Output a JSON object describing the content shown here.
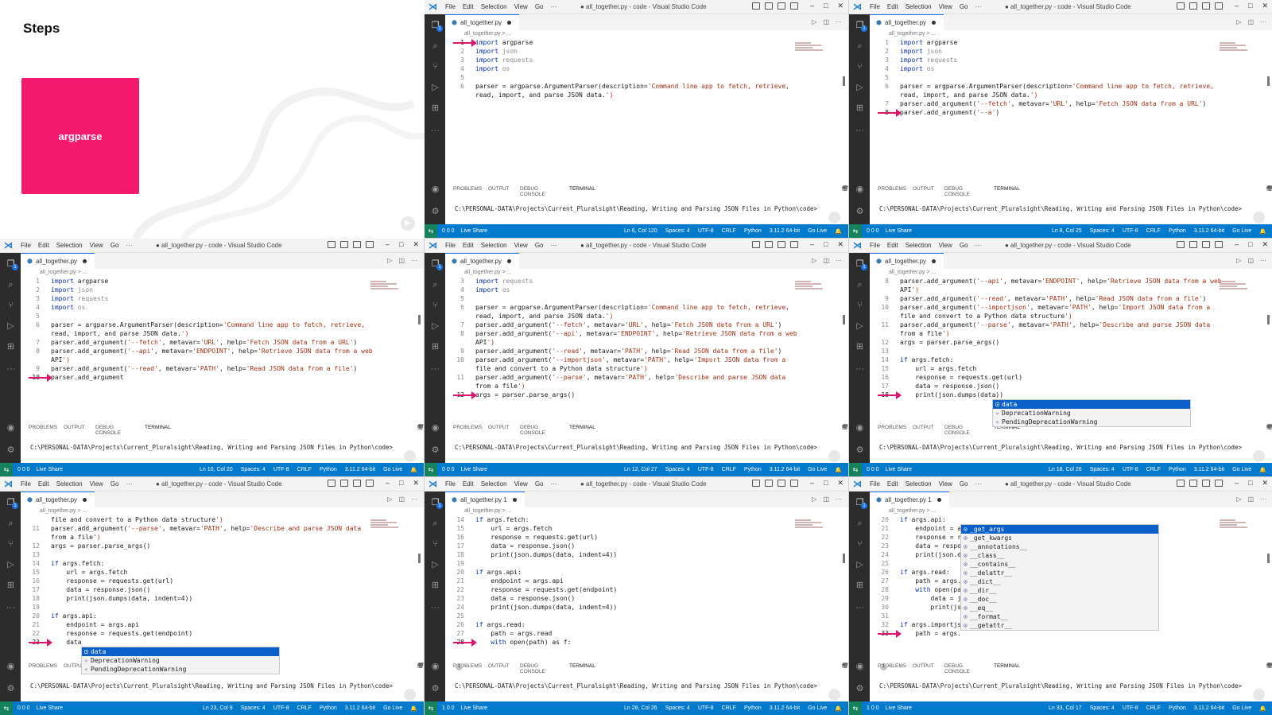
{
  "slide": {
    "title": "Steps",
    "card_label": "argparse"
  },
  "window": {
    "menu": [
      "File",
      "Edit",
      "Selection",
      "View",
      "Go",
      "···"
    ],
    "file": "all_together.py",
    "breadcrumb": "all_together.py > ...",
    "terminal_tabs": [
      "PROBLEMS",
      "OUTPUT",
      "DEBUG CONSOLE",
      "TERMINAL"
    ],
    "terminal_shell": "cmd",
    "terminal_prompt": "C:\\PERSONAL-DATA\\Projects\\Current_Pluralsight\\Reading, Writing and Parsing JSON Files in Python\\code>",
    "status_live_share": "Live Share",
    "status_spaces": "Spaces: 4",
    "status_encoding": "UTF-8",
    "status_eol": "CRLF",
    "status_language": "Python",
    "status_interpreter": "3.11.2 64-bit",
    "status_golive": "Go Live"
  },
  "colors": {
    "arrow": "#e0146d",
    "statusbar": "#007acc",
    "card": "#f3196f"
  },
  "panels": [
    {
      "title": "● all_together.py - code - Visual Studio Code",
      "tab": "all_together.py",
      "problems": "",
      "diagnostics": "0 0 0",
      "cursor": "Ln 6, Col 120",
      "arrow_line": 1,
      "lines": [
        {
          "n": "1",
          "t": "import argparse"
        },
        {
          "n": "2",
          "t": "import json"
        },
        {
          "n": "3",
          "t": "import requests"
        },
        {
          "n": "4",
          "t": "import os"
        },
        {
          "n": "5",
          "t": ""
        },
        {
          "n": "6",
          "t": "parser = argparse.ArgumentParser(description='Command line app to fetch, retrieve,"
        },
        {
          "n": "",
          "t": "read, import, and parse JSON data.')"
        }
      ],
      "autocomplete": []
    },
    {
      "title": "● all_together.py - code - Visual Studio Code",
      "tab": "all_together.py",
      "problems": "",
      "diagnostics": "0 0 0",
      "cursor": "Ln 8, Col 25",
      "arrow_line": 8,
      "lines": [
        {
          "n": "1",
          "t": "import argparse"
        },
        {
          "n": "2",
          "t": "import json"
        },
        {
          "n": "3",
          "t": "import requests"
        },
        {
          "n": "4",
          "t": "import os"
        },
        {
          "n": "5",
          "t": ""
        },
        {
          "n": "6",
          "t": "parser = argparse.ArgumentParser(description='Command line app to fetch, retrieve,"
        },
        {
          "n": "",
          "t": "read, import, and parse JSON data.')"
        },
        {
          "n": "7",
          "t": "parser.add_argument('--fetch', metavar='URL', help='Fetch JSON data from a URL')"
        },
        {
          "n": "8",
          "t": "parser.add_argument('--a')"
        }
      ],
      "autocomplete": []
    },
    {
      "title": "● all_together.py - code - Visual Studio Code",
      "tab": "all_together.py",
      "problems": "",
      "diagnostics": "0 0 0",
      "cursor": "Ln 10, Col 20",
      "arrow_line": 10,
      "lines": [
        {
          "n": "1",
          "t": "import argparse"
        },
        {
          "n": "2",
          "t": "import json"
        },
        {
          "n": "3",
          "t": "import requests"
        },
        {
          "n": "4",
          "t": "import os"
        },
        {
          "n": "5",
          "t": ""
        },
        {
          "n": "6",
          "t": "parser = argparse.ArgumentParser(description='Command line app to fetch, retrieve,"
        },
        {
          "n": "",
          "t": "read, import, and parse JSON data.')"
        },
        {
          "n": "7",
          "t": "parser.add_argument('--fetch', metavar='URL', help='Fetch JSON data from a URL')"
        },
        {
          "n": "8",
          "t": "parser.add_argument('--api', metavar='ENDPOINT', help='Retrieve JSON data from a web"
        },
        {
          "n": "",
          "t": "API')"
        },
        {
          "n": "9",
          "t": "parser.add_argument('--read', metavar='PATH', help='Read JSON data from a file')"
        },
        {
          "n": "10",
          "t": "parser.add_argument"
        }
      ],
      "autocomplete": []
    },
    {
      "title": "● all_together.py - code - Visual Studio Code",
      "tab": "all_together.py",
      "problems": "",
      "diagnostics": "0 0 0",
      "cursor": "Ln 12, Col 27",
      "arrow_line": 12,
      "lines": [
        {
          "n": "3",
          "t": "import requests"
        },
        {
          "n": "4",
          "t": "import os"
        },
        {
          "n": "5",
          "t": ""
        },
        {
          "n": "6",
          "t": "parser = argparse.ArgumentParser(description='Command line app to fetch, retrieve,"
        },
        {
          "n": "",
          "t": "read, import, and parse JSON data.')"
        },
        {
          "n": "7",
          "t": "parser.add_argument('--fetch', metavar='URL', help='Fetch JSON data from a URL')"
        },
        {
          "n": "8",
          "t": "parser.add_argument('--api', metavar='ENDPOINT', help='Retrieve JSON data from a web"
        },
        {
          "n": "",
          "t": "API')"
        },
        {
          "n": "9",
          "t": "parser.add_argument('--read', metavar='PATH', help='Read JSON data from a file')"
        },
        {
          "n": "10",
          "t": "parser.add_argument('--importjson', metavar='PATH', help='Import JSON data from a"
        },
        {
          "n": "",
          "t": "file and convert to a Python data structure')"
        },
        {
          "n": "11",
          "t": "parser.add_argument('--parse', metavar='PATH', help='Describe and parse JSON data"
        },
        {
          "n": "",
          "t": "from a file')"
        },
        {
          "n": "12",
          "t": "args = parser.parse_args()"
        }
      ],
      "autocomplete": []
    },
    {
      "title": "● all_together.py - code - Visual Studio Code",
      "tab": "all_together.py",
      "problems": "",
      "diagnostics": "0 0 0",
      "cursor": "Ln 18, Col 26",
      "arrow_line": 18,
      "lines": [
        {
          "n": "8",
          "t": "parser.add_argument('--api', metavar='ENDPOINT', help='Retrieve JSON data from a web"
        },
        {
          "n": "",
          "t": "API')"
        },
        {
          "n": "9",
          "t": "parser.add_argument('--read', metavar='PATH', help='Read JSON data from a file')"
        },
        {
          "n": "10",
          "t": "parser.add_argument('--importjson', metavar='PATH', help='Import JSON data from a"
        },
        {
          "n": "",
          "t": "file and convert to a Python data structure')"
        },
        {
          "n": "11",
          "t": "parser.add_argument('--parse', metavar='PATH', help='Describe and parse JSON data"
        },
        {
          "n": "",
          "t": "from a file')"
        },
        {
          "n": "12",
          "t": "args = parser.parse_args()"
        },
        {
          "n": "13",
          "t": ""
        },
        {
          "n": "14",
          "t": "if args.fetch:"
        },
        {
          "n": "15",
          "t": "    url = args.fetch"
        },
        {
          "n": "16",
          "t": "    response = requests.get(url)"
        },
        {
          "n": "17",
          "t": "    data = response.json()"
        },
        {
          "n": "18",
          "t": "    print(json.dumps(data))"
        }
      ],
      "autocomplete": [
        "data",
        "DeprecationWarning",
        "PendingDeprecationWarning"
      ]
    },
    {
      "title": "● all_together.py - code - Visual Studio Code",
      "tab": "all_together.py",
      "problems": "",
      "diagnostics": "0 0 0",
      "cursor": "Ln 23, Col 9",
      "arrow_line": 23,
      "lines": [
        {
          "n": "",
          "t": "file and convert to a Python data structure')"
        },
        {
          "n": "11",
          "t": "parser.add_argument('--parse', metavar='PATH', help='Describe and parse JSON data"
        },
        {
          "n": "",
          "t": "from a file')"
        },
        {
          "n": "12",
          "t": "args = parser.parse_args()"
        },
        {
          "n": "13",
          "t": ""
        },
        {
          "n": "14",
          "t": "if args.fetch:"
        },
        {
          "n": "15",
          "t": "    url = args.fetch"
        },
        {
          "n": "16",
          "t": "    response = requests.get(url)"
        },
        {
          "n": "17",
          "t": "    data = response.json()"
        },
        {
          "n": "18",
          "t": "    print(json.dumps(data, indent=4))"
        },
        {
          "n": "19",
          "t": ""
        },
        {
          "n": "20",
          "t": "if args.api:"
        },
        {
          "n": "21",
          "t": "    endpoint = args.api"
        },
        {
          "n": "22",
          "t": "    response = requests.get(endpoint)"
        },
        {
          "n": "23",
          "t": "    data"
        }
      ],
      "autocomplete": [
        "data",
        "DeprecationWarning",
        "PendingDeprecationWarning"
      ]
    },
    {
      "title": "● all_together.py - code - Visual Studio Code",
      "tab": "all_together.py 1",
      "problems": "1",
      "diagnostics": "1 0 0",
      "cursor": "Ln 28, Col 26",
      "arrow_line": 28,
      "lines": [
        {
          "n": "14",
          "t": "if args.fetch:"
        },
        {
          "n": "15",
          "t": "    url = args.fetch"
        },
        {
          "n": "16",
          "t": "    response = requests.get(url)"
        },
        {
          "n": "17",
          "t": "    data = response.json()"
        },
        {
          "n": "18",
          "t": "    print(json.dumps(data, indent=4))"
        },
        {
          "n": "19",
          "t": ""
        },
        {
          "n": "20",
          "t": "if args.api:"
        },
        {
          "n": "21",
          "t": "    endpoint = args.api"
        },
        {
          "n": "22",
          "t": "    response = requests.get(endpoint)"
        },
        {
          "n": "23",
          "t": "    data = response.json()"
        },
        {
          "n": "24",
          "t": "    print(json.dumps(data, indent=4))"
        },
        {
          "n": "25",
          "t": ""
        },
        {
          "n": "26",
          "t": "if args.read:"
        },
        {
          "n": "27",
          "t": "    path = args.read"
        },
        {
          "n": "28",
          "t": "    with open(path) as f:"
        }
      ],
      "autocomplete": []
    },
    {
      "title": "● all_together.py - code - Visual Studio Code",
      "tab": "all_together.py 1",
      "problems": "1",
      "diagnostics": "1 0 0",
      "cursor": "Ln 33, Col 17",
      "arrow_line": 33,
      "lines": [
        {
          "n": "20",
          "t": "if args.api:"
        },
        {
          "n": "21",
          "t": "    endpoint = a"
        },
        {
          "n": "22",
          "t": "    response = r"
        },
        {
          "n": "23",
          "t": "    data = respo"
        },
        {
          "n": "24",
          "t": "    print(json.d"
        },
        {
          "n": "25",
          "t": ""
        },
        {
          "n": "26",
          "t": "if args.read:"
        },
        {
          "n": "27",
          "t": "    path = args."
        },
        {
          "n": "28",
          "t": "    with open(pa"
        },
        {
          "n": "29",
          "t": "        data = j"
        },
        {
          "n": "30",
          "t": "        print(js"
        },
        {
          "n": "31",
          "t": ""
        },
        {
          "n": "32",
          "t": "if args.importjs"
        },
        {
          "n": "33",
          "t": "    path = args."
        }
      ],
      "autocomplete": [
        "_get_args",
        "_get_kwargs",
        "__annotations__",
        "__class__",
        "__contains__",
        "__delattr__",
        "__dict__",
        "__dir__",
        "__doc__",
        "__eq__",
        "__format__",
        "__getattr__"
      ]
    }
  ]
}
